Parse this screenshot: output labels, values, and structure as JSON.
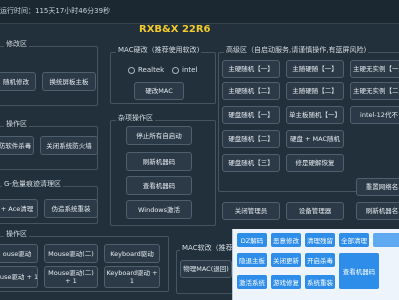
{
  "runtime": "运行时间：115天17小时46分39秒",
  "brand": "RXB&X 22R6",
  "groups": {
    "modify": "修改区",
    "mac": "MAC硬改（推荐使用软改)",
    "high": "高级区（自启动服务,请谨慎操作,有蓝屏风险)",
    "ops": "操作区",
    "misc": "杂项操作区",
    "cleanup": "G-危量痕迹清理区",
    "ops2": "操作区",
    "macsoft": "MAC软改（推荐"
  },
  "buttons": {
    "rand_mod": "随机修改",
    "bios": "换统屏板主板",
    "kill": "防软件杀毒",
    "firewall": "关闭系统防火墙",
    "ace": "+ Ace清理",
    "fake": "伪造系统重装",
    "mouse1": "ouse驱动",
    "mouse2": "Mouse驱动(二)",
    "kb1": "Keyboard驱动",
    "mouse3": "ouse驱动 + 1",
    "mouse4": "Mouse驱动(二) + 1",
    "kb2": "Keyboard驱动 + 1",
    "mac_hard": "硬改MAC",
    "stop_auto": "停止所有自启动",
    "refresh_code": "刷新机器码",
    "view_code": "查看机器码",
    "win_activate": "Windows激活",
    "close_mgr": "关闭管理员",
    "dev_mgr": "设备管理器",
    "reset_name": "重置网络名",
    "refresh_name": "刷新机器名",
    "mac_reset": "物理MAC(退回)"
  },
  "radios": {
    "realtek": "Realtek",
    "intel": "intel"
  },
  "high_grid": [
    [
      "主硬随机【一】",
      "主随硬随【一】",
      "主硬无实例【一】",
      "主硬无实例"
    ],
    [
      "主硬随机【二】",
      "主随硬随【二】",
      "主硬无实例【二】",
      "主硬无实例"
    ],
    [
      "硬盘随机【一】",
      "单主板随机【一】",
      "intel-12代不"
    ],
    [
      "硬盘随机【二】",
      "硬盘 + MAC随机"
    ],
    [
      "硬盘随机【三】",
      "修是硬解恢复"
    ]
  ],
  "blue": {
    "row1": [
      "DZ解码",
      "恶意修改",
      "清理残留",
      "全部清理",
      ""
    ],
    "row2": [
      "隐退主板",
      "关闭更新",
      "开启杀毒",
      "查看机器码"
    ],
    "row3": [
      "激活系统",
      "游戏修复",
      "系统重装"
    ]
  }
}
